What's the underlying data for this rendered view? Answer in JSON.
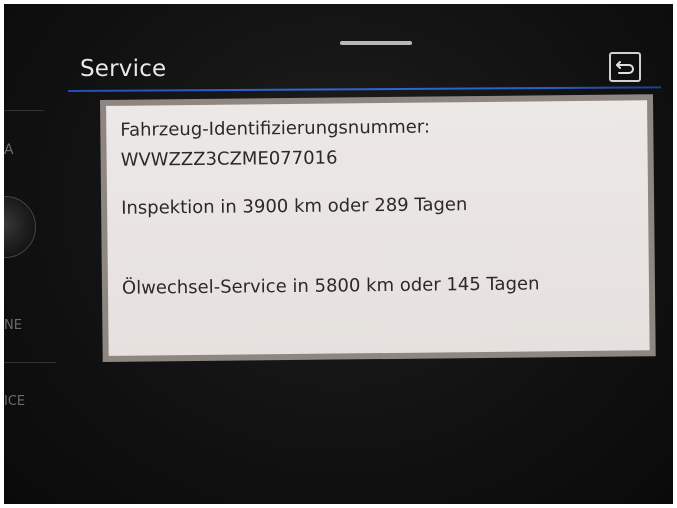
{
  "header": {
    "title": "Service",
    "back_icon": "back-arrow-icon"
  },
  "panel": {
    "vin_label": "Fahrzeug-Identifizierungsnummer:",
    "vin_value": "WVWZZZ3CZME077016",
    "inspection": "Inspektion in 3900 km oder 289 Tagen",
    "oil_service": "Ölwechsel-Service in 5800 km oder 145 Tagen"
  },
  "side_buttons": {
    "top": "A",
    "middle": "NE",
    "bottom": "ICE"
  },
  "colors": {
    "accent_rule": "#2d68d8",
    "panel_bg": "#e8e4e1",
    "title_text": "#e8e8e8",
    "body_text": "#2a2a2a"
  }
}
